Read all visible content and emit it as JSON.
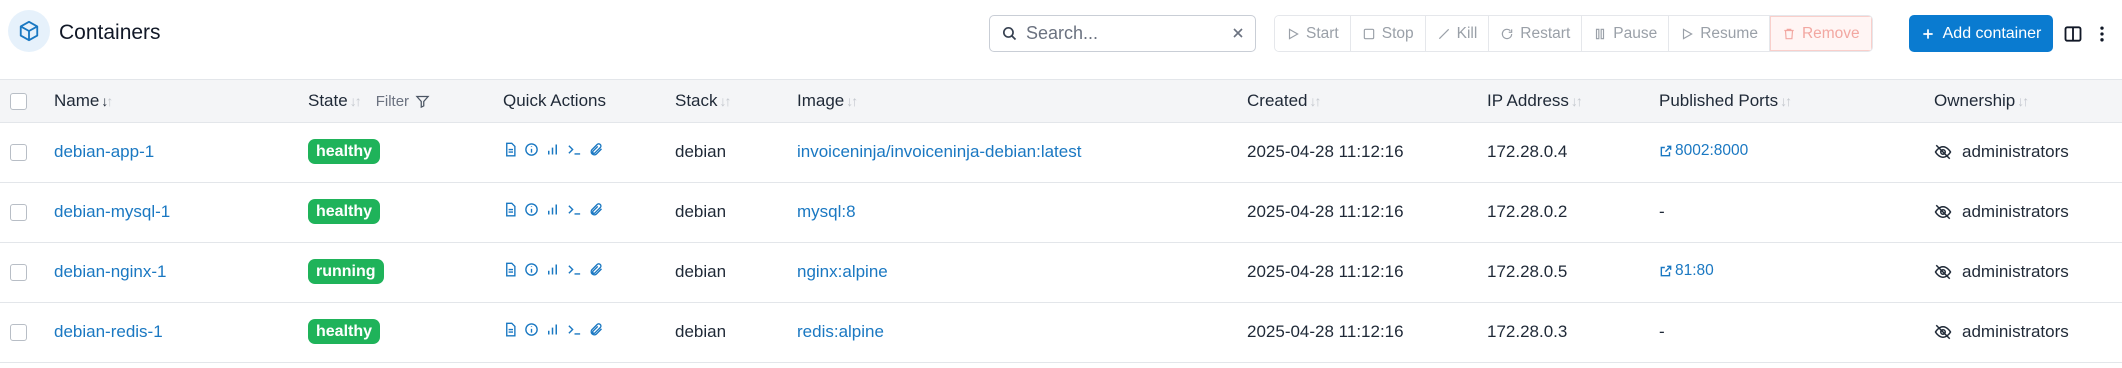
{
  "header": {
    "title": "Containers",
    "search_placeholder": "Search...",
    "actions": {
      "start": "Start",
      "stop": "Stop",
      "kill": "Kill",
      "restart": "Restart",
      "pause": "Pause",
      "resume": "Resume",
      "remove": "Remove"
    },
    "add_container": "Add container"
  },
  "columns": {
    "name": "Name",
    "state": "State",
    "filter": "Filter",
    "quick_actions": "Quick Actions",
    "stack": "Stack",
    "image": "Image",
    "created": "Created",
    "ip": "IP Address",
    "ports": "Published Ports",
    "ownership": "Ownership"
  },
  "rows": [
    {
      "name": "debian-app-1",
      "state": "healthy",
      "stack": "debian",
      "image": "invoiceninja/invoiceninja-debian:latest",
      "created": "2025-04-28 11:12:16",
      "ip": "172.28.0.4",
      "port": "8002:8000",
      "ownership": "administrators"
    },
    {
      "name": "debian-mysql-1",
      "state": "healthy",
      "stack": "debian",
      "image": "mysql:8",
      "created": "2025-04-28 11:12:16",
      "ip": "172.28.0.2",
      "port": "-",
      "ownership": "administrators"
    },
    {
      "name": "debian-nginx-1",
      "state": "running",
      "stack": "debian",
      "image": "nginx:alpine",
      "created": "2025-04-28 11:12:16",
      "ip": "172.28.0.5",
      "port": "81:80",
      "ownership": "administrators"
    },
    {
      "name": "debian-redis-1",
      "state": "healthy",
      "stack": "debian",
      "image": "redis:alpine",
      "created": "2025-04-28 11:12:16",
      "ip": "172.28.0.3",
      "port": "-",
      "ownership": "administrators"
    }
  ],
  "colors": {
    "accent": "#0a7bd0",
    "link": "#1a78c2",
    "badge": "#1fb35a",
    "remove": "#f2a7a1"
  }
}
